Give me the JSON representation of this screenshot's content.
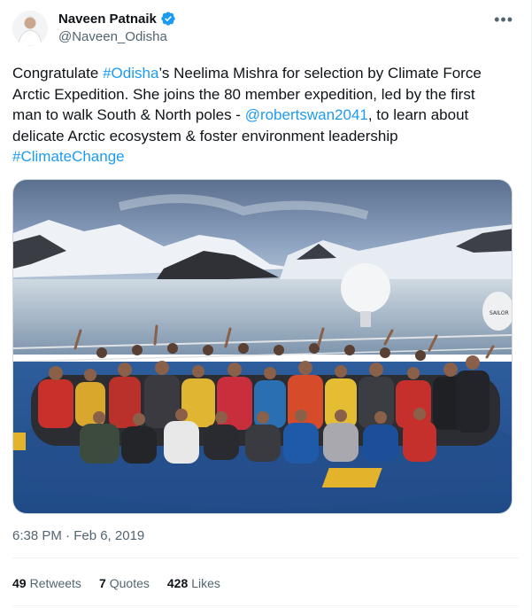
{
  "author": {
    "display_name": "Naveen Patnaik",
    "handle": "@Naveen_Odisha",
    "verified_icon": "verified-badge-icon",
    "verified_color": "#1d9bf0"
  },
  "more_icon": "•••",
  "tweet": {
    "segments": [
      {
        "text": "Congratulate ",
        "link": false
      },
      {
        "text": "#Odisha",
        "link": true
      },
      {
        "text": "’s Neelima Mishra for selection by Climate Force Arctic Expedition. She  joins the 80 member expedition, led by the first man to walk South & North poles - ",
        "link": false
      },
      {
        "text": "@robertswan2041",
        "link": true
      },
      {
        "text": ", to learn about delicate Arctic ecosystem & foster environment leadership ",
        "link": false
      },
      {
        "text": "#ClimateChange",
        "link": true
      }
    ],
    "link_color": "#1d9bf0"
  },
  "photo": {
    "ship_label": "SAILOR"
  },
  "timestamp": "6:38 PM · Feb 6, 2019",
  "stats": {
    "retweets_count": "49",
    "retweets_label": "Retweets",
    "quotes_count": "7",
    "quotes_label": "Quotes",
    "likes_count": "428",
    "likes_label": "Likes"
  }
}
